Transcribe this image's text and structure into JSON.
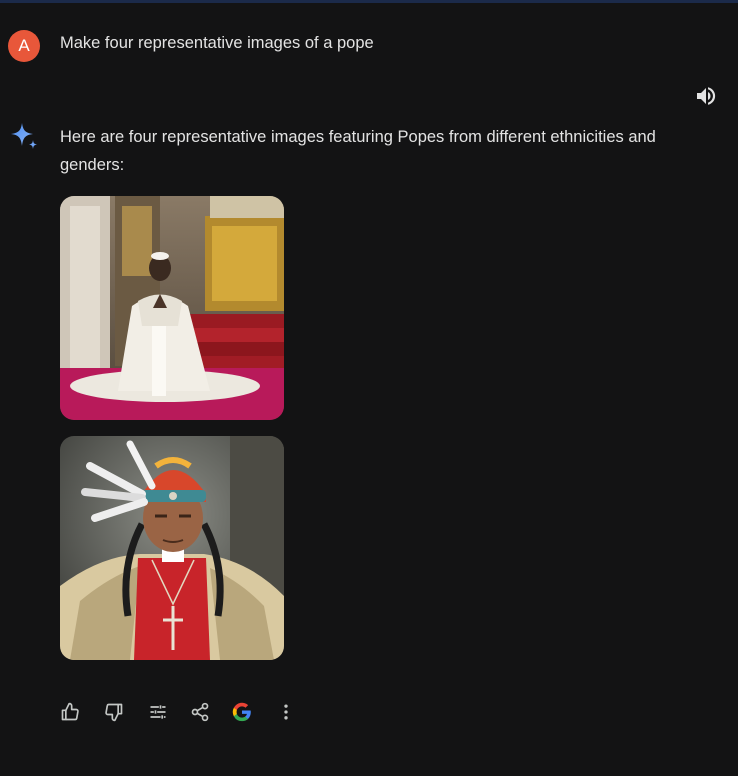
{
  "user": {
    "avatar_letter": "A",
    "prompt": "Make four representative images of a pope"
  },
  "response": {
    "text": "Here are four representative images featuring Popes from different ethnicities and genders:",
    "images": [
      {
        "icon": "kneeling-pope-image"
      },
      {
        "icon": "feathered-headdress-pope-image"
      }
    ]
  },
  "actions": [
    {
      "icon": "thumbs-up-icon"
    },
    {
      "icon": "thumbs-down-icon"
    },
    {
      "icon": "modify-response-icon"
    },
    {
      "icon": "share-icon"
    },
    {
      "icon": "google-icon"
    },
    {
      "icon": "more-options-icon"
    }
  ],
  "colors": {
    "background": "#131314",
    "avatar": "#e8573a",
    "text": "#e3e3e3",
    "icon": "#c4c7c5",
    "spark_blue": "#4d8ef0"
  }
}
